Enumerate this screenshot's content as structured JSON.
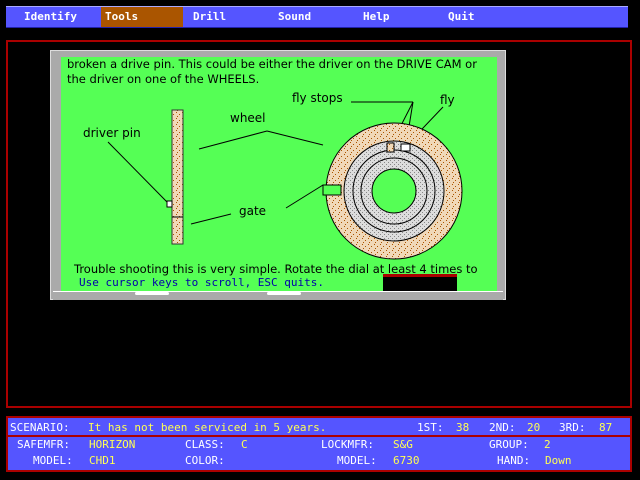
{
  "menu": {
    "items": [
      {
        "label": "Identify"
      },
      {
        "label": "Tools"
      },
      {
        "label": "Drill"
      },
      {
        "label": "Sound"
      },
      {
        "label": "Help"
      },
      {
        "label": "Quit"
      }
    ],
    "active": "Tools"
  },
  "help": {
    "line1": "broken a drive pin. This could be either the driver on the DRIVE CAM or",
    "line2": "the driver on one of the WHEELS.",
    "line3": "Trouble shooting this is very simple. Rotate the dial at least 4 times to",
    "scroll_hint": "Use cursor keys to scroll, ESC quits."
  },
  "diagram": {
    "label_driver_pin": "driver pin",
    "label_wheel": "wheel",
    "label_fly_stops": "fly stops",
    "label_fly": "fly",
    "label_gate": "gate"
  },
  "status": {
    "scenario_label": "SCENARIO:",
    "scenario_value": "It has not been serviced in 5 years.",
    "first_label": "1ST:",
    "first_value": "38",
    "second_label": "2ND:",
    "second_value": "20",
    "third_label": "3RD:",
    "third_value": "87",
    "safemfr_label": "SAFEMFR:",
    "safemfr_value": "HORIZON",
    "class_label": "CLASS:",
    "class_value": "C",
    "lockmfr_label": "LOCKMFR:",
    "lockmfr_value": "S&G",
    "group_label": "GROUP:",
    "group_value": "2",
    "model_label": "MODEL:",
    "model_value": "CHD1",
    "color_label": "COLOR:",
    "color_value": "",
    "model2_label": "MODEL:",
    "model2_value": "6730",
    "hand_label": "HAND:",
    "hand_value": "Down"
  },
  "colors": {
    "menu_bg": "#5555ff",
    "menu_active": "#aa5500",
    "frame_border": "#aa0000",
    "help_bg": "#55ff55",
    "status_value": "#ffff55"
  }
}
